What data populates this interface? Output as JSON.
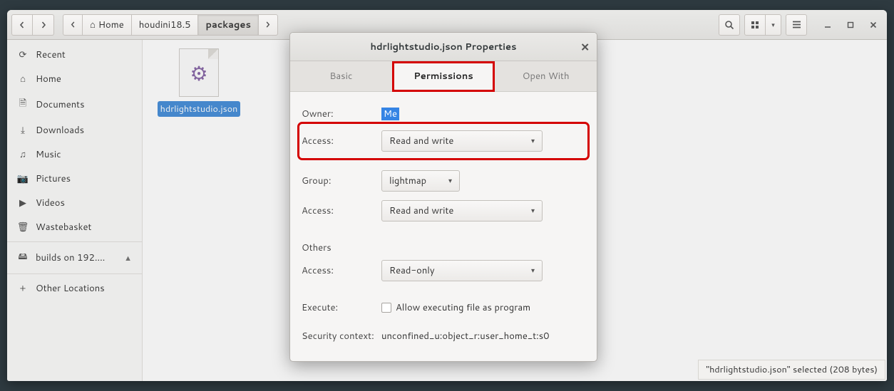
{
  "toolbar": {
    "path": {
      "home_label": "Home",
      "seg1": "houdini18.5",
      "seg2": "packages"
    }
  },
  "sidebar": {
    "items": [
      {
        "icon": "⟳",
        "label": "Recent"
      },
      {
        "icon": "⌂",
        "label": "Home"
      },
      {
        "icon": "🗎",
        "label": "Documents"
      },
      {
        "icon": "⤓",
        "label": "Downloads"
      },
      {
        "icon": "♫",
        "label": "Music"
      },
      {
        "icon": "📷",
        "label": "Pictures"
      },
      {
        "icon": "▶",
        "label": "Videos"
      },
      {
        "icon": "🗑",
        "label": "Wastebasket"
      }
    ],
    "mount": {
      "icon": "🖴",
      "label": "builds on 192.…"
    },
    "other": {
      "icon": "+",
      "label": "Other Locations"
    }
  },
  "file": {
    "name": "hdrlightstudio.json"
  },
  "statusbar": {
    "text": "\"hdrlightstudio.json\" selected  (208 bytes)"
  },
  "dialog": {
    "title": "hdrlightstudio.json Properties",
    "tabs": {
      "basic": "Basic",
      "permissions": "Permissions",
      "openwith": "Open With"
    },
    "labels": {
      "owner": "Owner:",
      "access": "Access:",
      "group": "Group:",
      "others": "Others",
      "execute": "Execute:",
      "security": "Security context:"
    },
    "values": {
      "owner_me": "Me",
      "owner_access": "Read and write",
      "group_name": "lightmap",
      "group_access": "Read and write",
      "others_access": "Read-only",
      "execute_label": "Allow executing file as program",
      "security_context": "unconfined_u:object_r:user_home_t:s0"
    }
  }
}
